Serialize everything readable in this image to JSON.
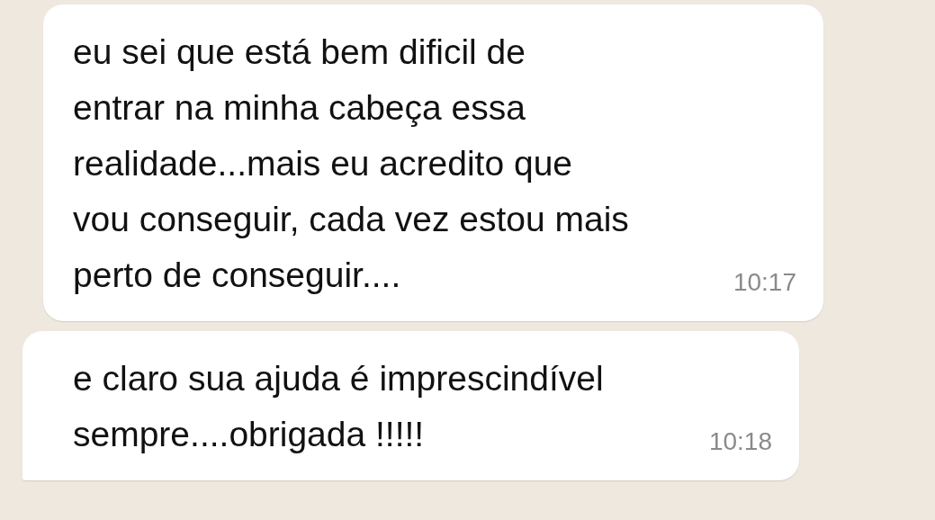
{
  "messages": [
    {
      "lines": [
        "eu sei que está bem dificil de",
        "entrar na minha cabeça essa",
        "realidade...mais eu acredito que",
        "vou conseguir, cada vez estou mais",
        "perto de conseguir...."
      ],
      "time": "10:17",
      "tail": false
    },
    {
      "lines": [
        "e claro sua ajuda é imprescindível",
        "sempre....obrigada !!!!!"
      ],
      "time": "10:18",
      "tail": true
    }
  ]
}
